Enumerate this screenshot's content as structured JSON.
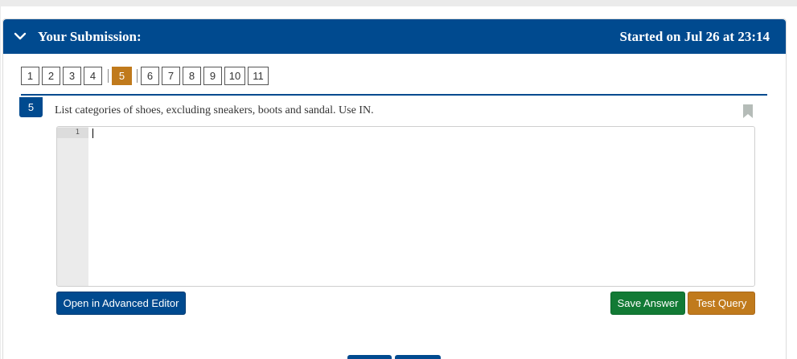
{
  "header": {
    "title": "Your Submission:",
    "started": "Started on Jul 26 at 23:14"
  },
  "question_nav": {
    "items": [
      "1",
      "2",
      "3",
      "4",
      "5",
      "6",
      "7",
      "8",
      "9",
      "10",
      "11"
    ],
    "active": "5"
  },
  "question": {
    "number": "5",
    "text": "List categories of shoes, excluding sneakers, boots and sandal.  Use IN."
  },
  "editor": {
    "line_numbers": [
      "1"
    ],
    "value": ""
  },
  "buttons": {
    "advanced_editor": "Open in Advanced Editor",
    "save_answer": "Save Answer",
    "test_query": "Test Query"
  },
  "colors": {
    "header_blue": "#004a8f",
    "active_orange": "#c07a1c",
    "save_green": "#127a35"
  },
  "icons": {
    "collapse": "chevron-down-icon",
    "bookmark": "bookmark-icon"
  }
}
